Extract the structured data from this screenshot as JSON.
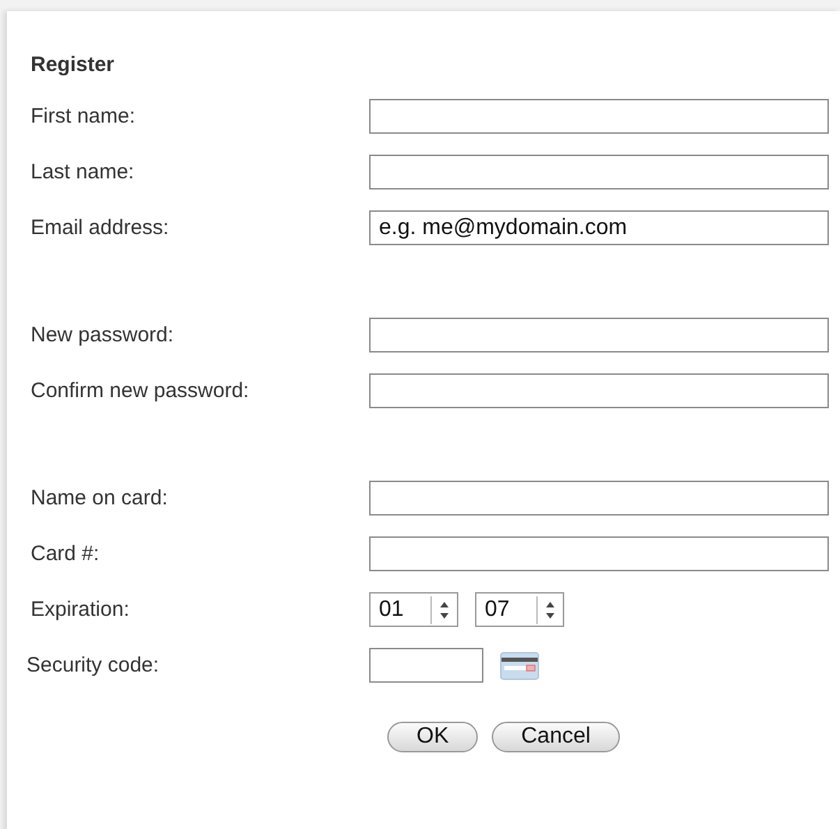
{
  "title": "Register",
  "sections": [
    [
      {
        "kind": "text",
        "label": "First name:"
      },
      {
        "kind": "text",
        "label": "Last name:"
      },
      {
        "kind": "text",
        "label": "Email address:",
        "value": "e.g. me@mydomain.com"
      }
    ],
    [
      {
        "kind": "text",
        "label": "New password:"
      },
      {
        "kind": "text",
        "label": "Confirm new password:"
      }
    ],
    [
      {
        "kind": "text",
        "label": "Name on card:"
      },
      {
        "kind": "text",
        "label": "Card #:"
      },
      {
        "kind": "selects",
        "label": "Expiration:",
        "selects": [
          "01",
          "07"
        ]
      },
      {
        "kind": "code",
        "label": "Security code:"
      }
    ]
  ],
  "buttons": [
    "OK",
    "Cancel"
  ]
}
